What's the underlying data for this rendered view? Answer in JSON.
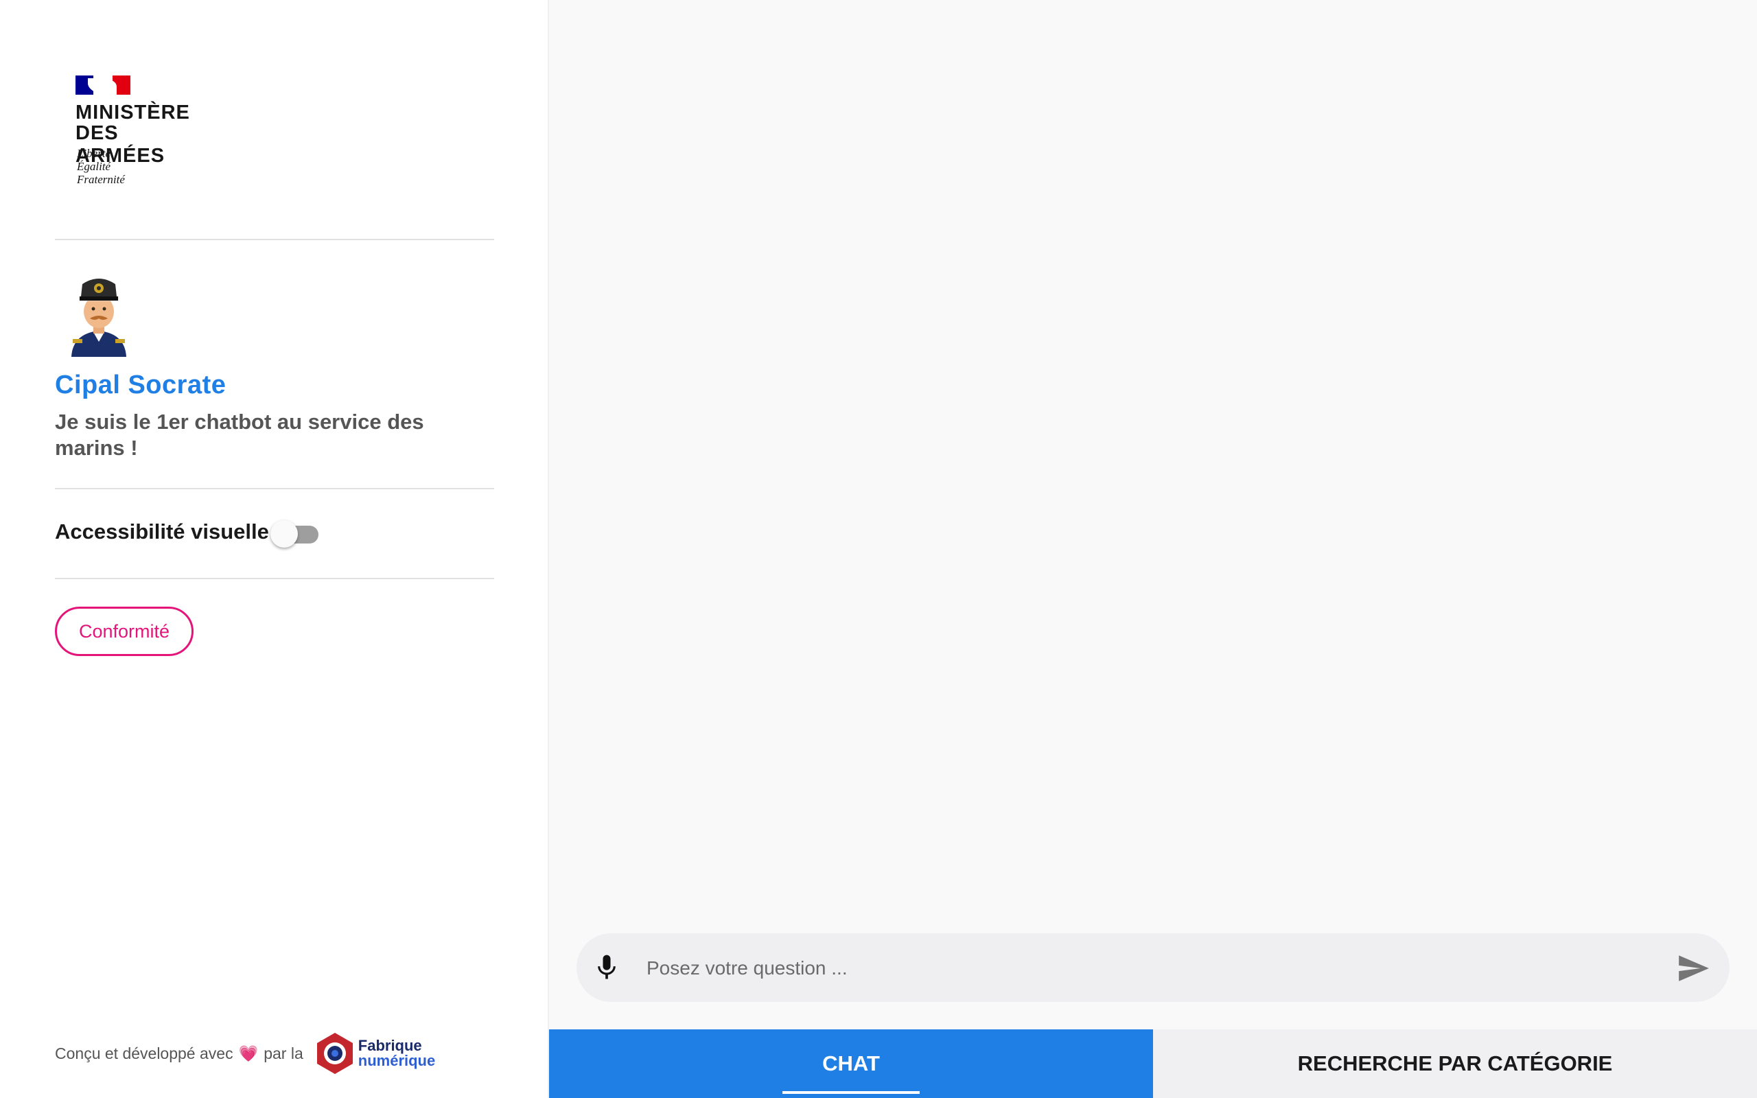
{
  "sidebar": {
    "logo": {
      "line1": "MINISTÈRE",
      "line2": "DES ARMÉES",
      "motto1": "Liberté",
      "motto2": "Égalité",
      "motto3": "Fraternité"
    },
    "bot_name": "Cipal Socrate",
    "bot_description": "Je suis le 1er chatbot au service des marins !",
    "accessibility_label": "Accessibilité visuelle",
    "accessibility_enabled": false,
    "conformity_button": "Conformité",
    "footer": {
      "text_before": "Conçu et développé avec",
      "heart": "💗",
      "text_after": "par la",
      "brand_line1": "Fabrique",
      "brand_line2": "numérique"
    }
  },
  "composer": {
    "placeholder": "Posez votre question ..."
  },
  "tabs": [
    {
      "label": "CHAT",
      "active": true
    },
    {
      "label": "RECHERCHE PAR CATÉGORIE",
      "active": false
    }
  ],
  "colors": {
    "accent": "#1f7fe5",
    "conformity": "#e4157a",
    "flag_blue": "#000091",
    "flag_red": "#e1000f"
  },
  "icons": [
    "marianne-flag-icon",
    "sailor-avatar-icon",
    "microphone-icon",
    "send-icon",
    "fabrique-numerique-logo-icon"
  ]
}
